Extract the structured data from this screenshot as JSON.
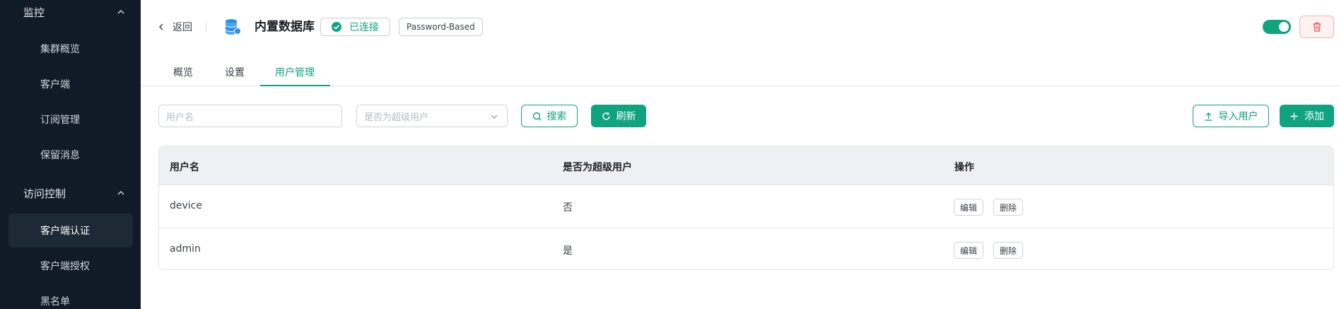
{
  "sidebar": {
    "groups": [
      {
        "label": "监控"
      },
      {
        "label": "访问控制"
      }
    ],
    "items": [
      {
        "label": "集群概览"
      },
      {
        "label": "客户端"
      },
      {
        "label": "订阅管理"
      },
      {
        "label": "保留消息"
      },
      {
        "label": "客户端认证"
      },
      {
        "label": "客户端授权"
      },
      {
        "label": "黑名单"
      }
    ]
  },
  "header": {
    "back_label": "返回",
    "title": "内置数据库",
    "status": "已连接",
    "auth_type": "Password-Based",
    "enabled": true
  },
  "tabs": [
    {
      "label": "概览"
    },
    {
      "label": "设置"
    },
    {
      "label": "用户管理"
    }
  ],
  "filters": {
    "username_placeholder": "用户名",
    "superuser_placeholder": "是否为超级用户",
    "search_label": "搜索",
    "refresh_label": "刷新",
    "import_label": "导入用户",
    "add_label": "添加"
  },
  "table": {
    "columns": [
      "用户名",
      "是否为超级用户",
      "操作"
    ],
    "rows": [
      {
        "username": "device",
        "superuser": "否",
        "edit": "编辑",
        "delete": "删除"
      },
      {
        "username": "admin",
        "superuser": "是",
        "edit": "编辑",
        "delete": "删除"
      }
    ]
  },
  "colors": {
    "accent": "#0fa37f",
    "sidebar_bg": "#111b27",
    "danger": "#e05a5a"
  }
}
